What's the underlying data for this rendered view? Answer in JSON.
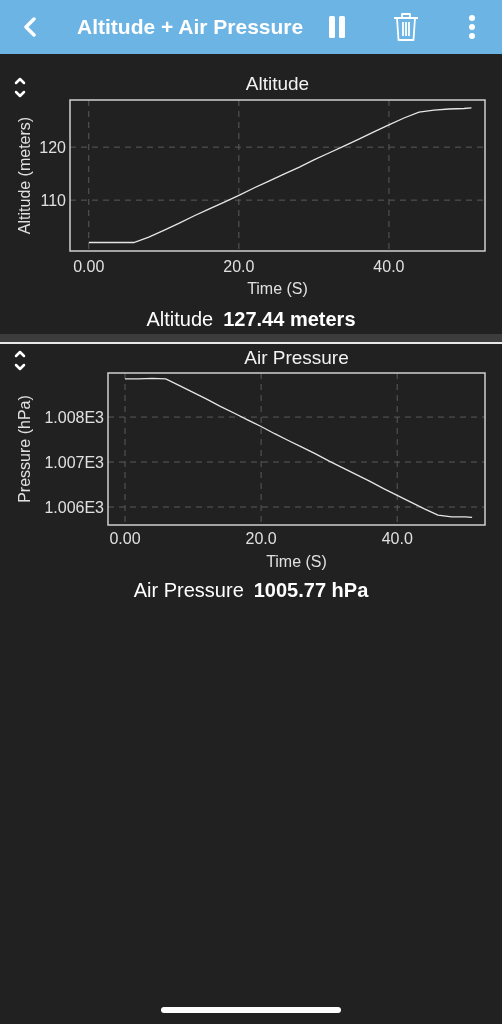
{
  "header": {
    "title": "Altitude + Air Pressure"
  },
  "panels": [
    {
      "chart_data": {
        "type": "line",
        "title": "Altitude",
        "xlabel": "Time (S)",
        "ylabel": "Altitude (meters)",
        "x": [
          0,
          2,
          4,
          6,
          8,
          10,
          12,
          14,
          16,
          18,
          20,
          22,
          24,
          26,
          28,
          30,
          32,
          34,
          36,
          38,
          40,
          42,
          44,
          46,
          48,
          50,
          51
        ],
        "series": [
          {
            "color": "#e6e6e6",
            "values": [
              102.0,
              102.0,
              102.0,
              102.0,
              103.0,
              104.3,
              105.6,
              107.0,
              108.3,
              109.6,
              110.9,
              112.3,
              113.6,
              114.9,
              116.2,
              117.6,
              118.9,
              120.2,
              121.5,
              122.9,
              124.2,
              125.5,
              126.6,
              127.0,
              127.2,
              127.3,
              127.4
            ]
          }
        ],
        "grid": true,
        "xlim": [
          -2.5,
          52.8
        ],
        "ylim": [
          100.4,
          128.9
        ],
        "xticks": [
          {
            "value": 0,
            "label": "0.00"
          },
          {
            "value": 20,
            "label": "20.0"
          },
          {
            "value": 40,
            "label": "40.0"
          }
        ],
        "yticks": [
          {
            "value": 110,
            "label": "110"
          },
          {
            "value": 120,
            "label": "120"
          }
        ]
      },
      "readout": {
        "label": "Altitude",
        "value": "127.44 meters"
      }
    },
    {
      "chart_data": {
        "type": "line",
        "title": "Air Pressure",
        "xlabel": "Time (S)",
        "ylabel": "Pressure (hPa)",
        "x": [
          0,
          2,
          4,
          6,
          8,
          10,
          12,
          14,
          16,
          18,
          20,
          22,
          24,
          26,
          28,
          30,
          32,
          34,
          36,
          38,
          40,
          42,
          44,
          46,
          48,
          50,
          51
        ],
        "grid": true,
        "series": [
          {
            "color": "#e6e6e6",
            "values": [
              1008.85,
              1008.85,
              1008.86,
              1008.85,
              1008.7,
              1008.55,
              1008.4,
              1008.24,
              1008.09,
              1007.94,
              1007.79,
              1007.63,
              1007.48,
              1007.33,
              1007.18,
              1007.02,
              1006.87,
              1006.72,
              1006.57,
              1006.41,
              1006.26,
              1006.11,
              1005.96,
              1005.82,
              1005.78,
              1005.78,
              1005.77
            ]
          }
        ],
        "xlim": [
          -2.5,
          52.9
        ],
        "ylim": [
          1005.6,
          1008.98
        ],
        "xticks": [
          {
            "value": 0,
            "label": "0.00"
          },
          {
            "value": 20,
            "label": "20.0"
          },
          {
            "value": 40,
            "label": "40.0"
          }
        ],
        "yticks": [
          {
            "value": 1006,
            "label": "1.006E3"
          },
          {
            "value": 1007,
            "label": "1.007E3"
          },
          {
            "value": 1008,
            "label": "1.008E3"
          }
        ]
      },
      "readout": {
        "label": "Air Pressure",
        "value": "1005.77 hPa"
      }
    }
  ]
}
